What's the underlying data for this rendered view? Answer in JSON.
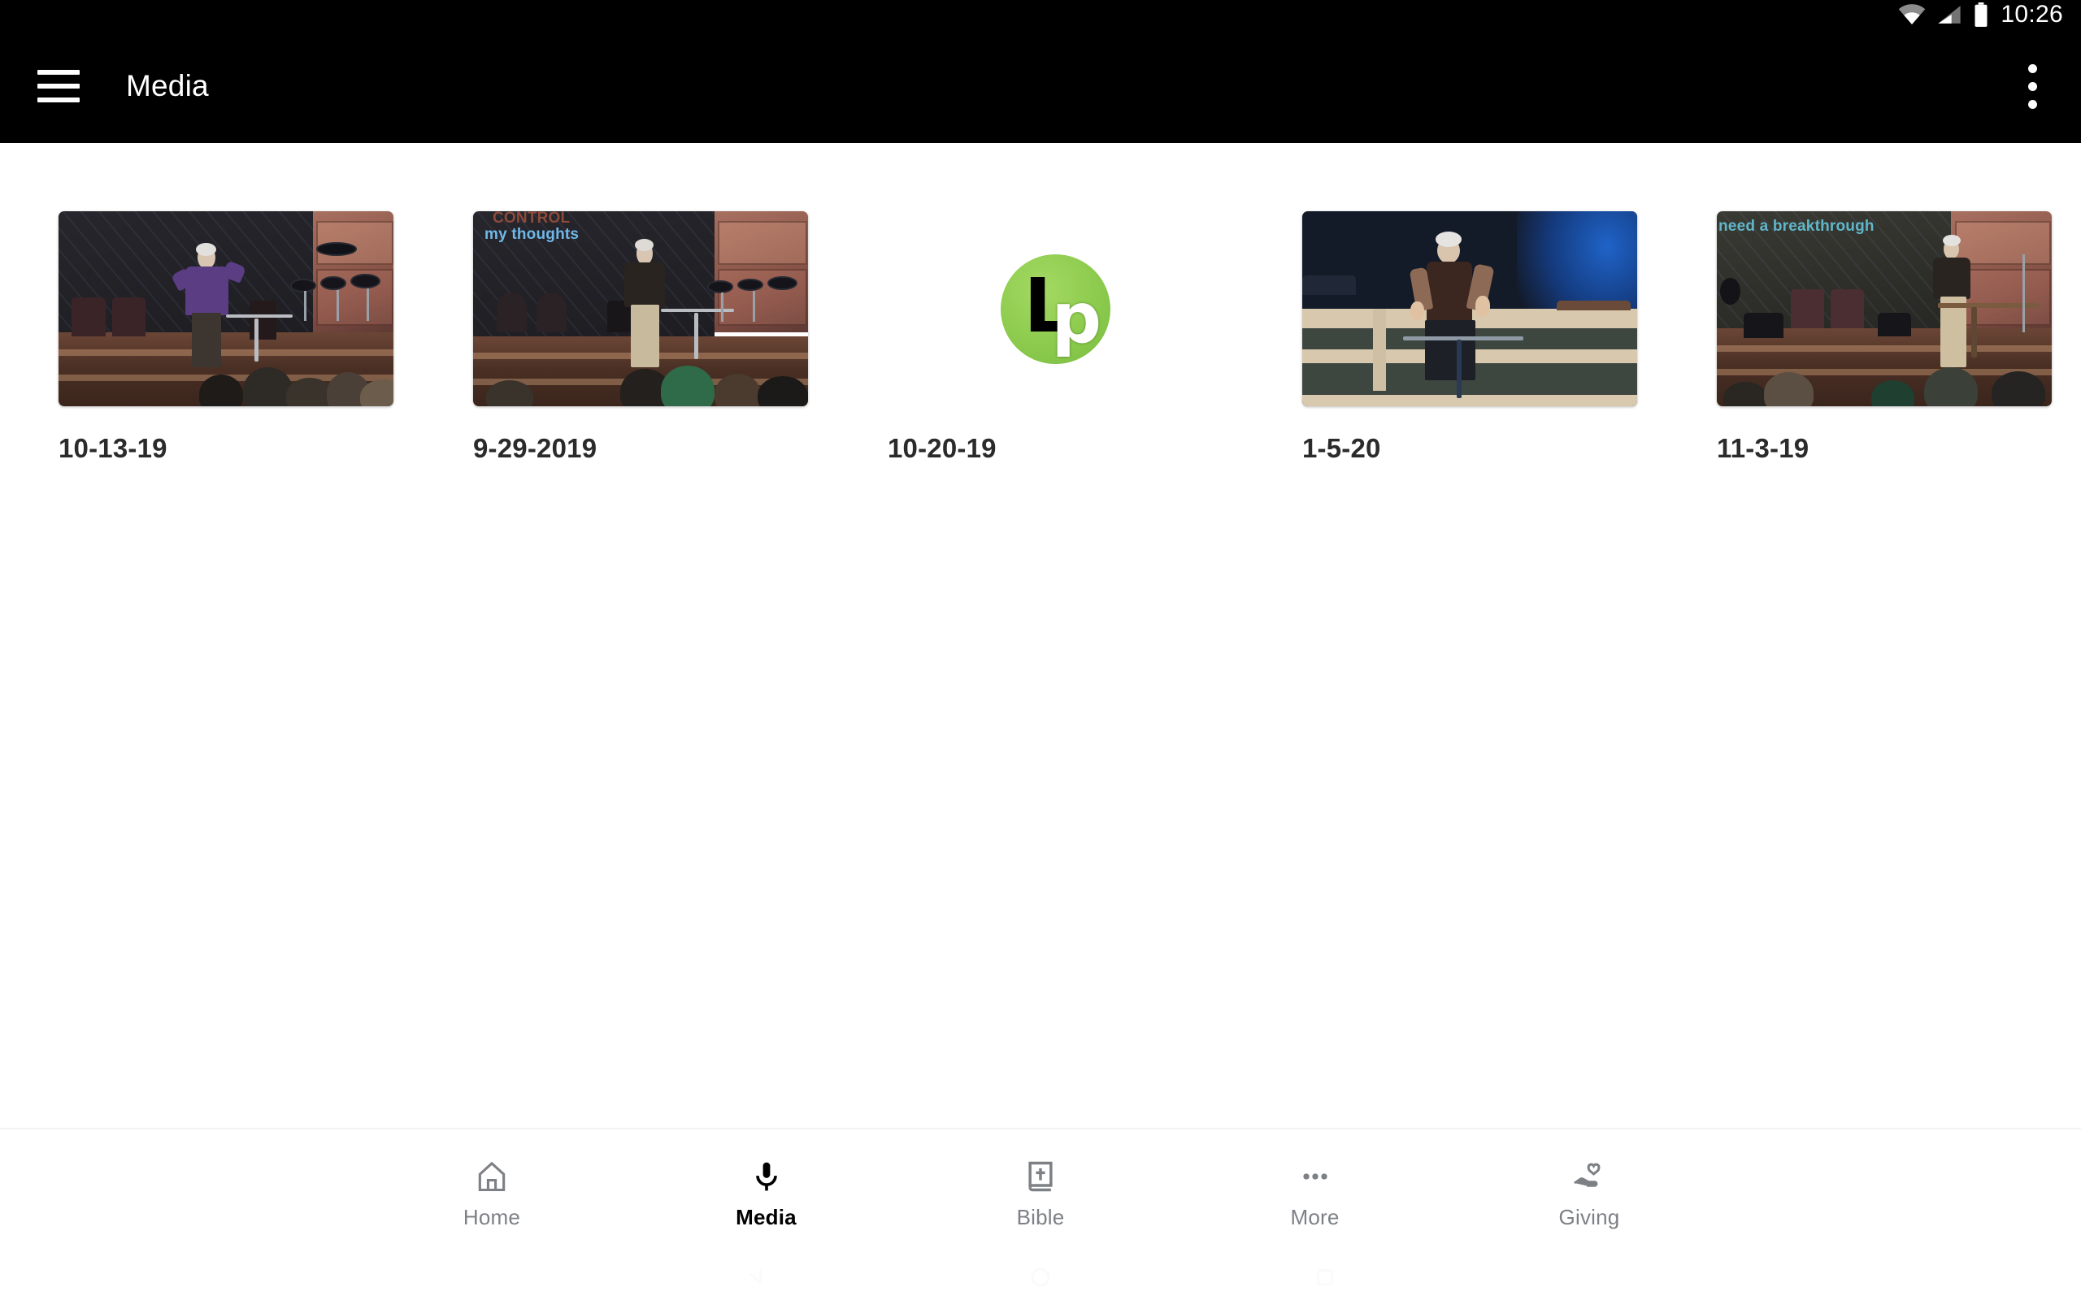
{
  "status_bar": {
    "time": "10:26",
    "icons": [
      "wifi-icon",
      "cellular-signal-icon",
      "battery-icon"
    ]
  },
  "app_bar": {
    "menu_icon": "hamburger-menu-icon",
    "title": "Media",
    "overflow_icon": "overflow-menu-icon"
  },
  "media_grid": {
    "items": [
      {
        "label": "10-13-19",
        "thumbnail_type": "video-frame",
        "overlay_caption": "",
        "description": "speaker in purple shirt on stage"
      },
      {
        "label": "9-29-2019",
        "thumbnail_type": "video-frame",
        "overlay_caption": "my thoughts",
        "overlay_caption_secondary": "CONTROL",
        "description": "speaker in dark shirt and khakis on stage"
      },
      {
        "label": "10-20-19",
        "thumbnail_type": "logo-placeholder",
        "logo_text_primary": "L",
        "logo_text_secondary": "p",
        "overlay_caption": "",
        "description": "green circular LP logo placeholder"
      },
      {
        "label": "1-5-20",
        "thumbnail_type": "video-frame",
        "overlay_caption": "",
        "description": "speaker seated in brown vest with blue backdrop"
      },
      {
        "label": "11-3-19",
        "thumbnail_type": "video-frame",
        "overlay_caption": "need a breakthrough",
        "description": "speaker at podium on stage"
      }
    ]
  },
  "bottom_nav": {
    "active": "Media",
    "items": [
      {
        "label": "Home",
        "icon": "home-icon"
      },
      {
        "label": "Media",
        "icon": "microphone-icon"
      },
      {
        "label": "Bible",
        "icon": "bible-book-icon"
      },
      {
        "label": "More",
        "icon": "more-dots-icon"
      },
      {
        "label": "Giving",
        "icon": "hand-heart-icon"
      }
    ]
  },
  "system_nav": {
    "items": [
      {
        "icon": "back-icon"
      },
      {
        "icon": "home-circle-icon"
      },
      {
        "icon": "recents-square-icon"
      }
    ]
  },
  "colors": {
    "app_bar_bg": "#000000",
    "page_bg": "#ffffff",
    "label_text": "#2b2b2b",
    "nav_inactive": "#7d8085",
    "nav_active": "#000000",
    "logo_green": "#8ccb4e",
    "caption_blue": "#6fb8e8",
    "caption_teal": "#5fb7c9"
  }
}
